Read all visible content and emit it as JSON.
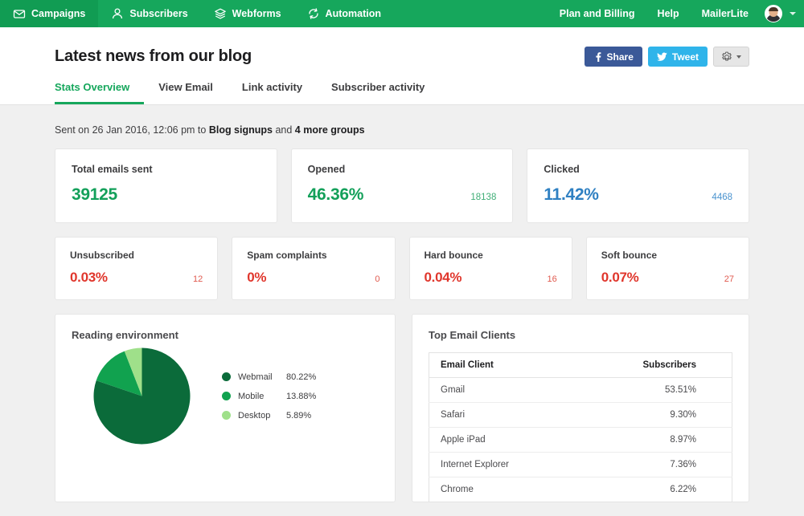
{
  "topnav": {
    "items": [
      {
        "label": "Campaigns",
        "icon": "envelope-icon",
        "active": true
      },
      {
        "label": "Subscribers",
        "icon": "user-icon",
        "active": false
      },
      {
        "label": "Webforms",
        "icon": "layers-icon",
        "active": false
      },
      {
        "label": "Automation",
        "icon": "refresh-icon",
        "active": false
      }
    ],
    "links": [
      {
        "label": "Plan and Billing"
      },
      {
        "label": "Help"
      },
      {
        "label": "MailerLite"
      }
    ],
    "avatar_name": "user-avatar",
    "caret_name": "account-chevron-down-icon",
    "bg_color": "#16a75c",
    "active_bg_color": "#119c53"
  },
  "header": {
    "title": "Latest news from our blog",
    "share_label": "Share",
    "tweet_label": "Tweet",
    "share_color": "#3b5998",
    "tweet_color": "#2fb4ea",
    "settings_icon": "gear-icon"
  },
  "tabs": [
    {
      "label": "Stats Overview",
      "active": true
    },
    {
      "label": "View Email",
      "active": false
    },
    {
      "label": "Link activity",
      "active": false
    },
    {
      "label": "Subscriber activity",
      "active": false
    }
  ],
  "sent_line": {
    "prefix": "Sent on 26 Jan 2016, 12:06 pm to ",
    "group": "Blog signups",
    "middle": " and ",
    "more": "4 more groups"
  },
  "stats_primary": [
    {
      "label": "Total emails sent",
      "value": "39125",
      "count": "",
      "color": "green"
    },
    {
      "label": "Opened",
      "value": "46.36%",
      "count": "18138",
      "color": "green"
    },
    {
      "label": "Clicked",
      "value": "11.42%",
      "count": "4468",
      "color": "blue"
    }
  ],
  "stats_secondary": [
    {
      "label": "Unsubscribed",
      "value": "0.03%",
      "count": "12",
      "color": "red"
    },
    {
      "label": "Spam complaints",
      "value": "0%",
      "count": "0",
      "color": "red"
    },
    {
      "label": "Hard bounce",
      "value": "0.04%",
      "count": "16",
      "color": "red"
    },
    {
      "label": "Soft bounce",
      "value": "0.07%",
      "count": "27",
      "color": "red"
    }
  ],
  "reading_environment": {
    "title": "Reading environment"
  },
  "top_email_clients": {
    "title": "Top Email Clients",
    "columns": [
      "Email Client",
      "Subscribers"
    ],
    "rows": [
      {
        "client": "Gmail",
        "subscribers": "53.51%"
      },
      {
        "client": "Safari",
        "subscribers": "9.30%"
      },
      {
        "client": "Apple iPad",
        "subscribers": "8.97%"
      },
      {
        "client": "Internet Explorer",
        "subscribers": "7.36%"
      },
      {
        "client": "Chrome",
        "subscribers": "6.22%"
      }
    ]
  },
  "chart_data": {
    "type": "pie",
    "title": "Reading environment",
    "categories": [
      "Webmail",
      "Mobile",
      "Desktop"
    ],
    "values": [
      80.22,
      13.88,
      5.89
    ],
    "labels": [
      "80.22%",
      "13.88%",
      "5.89%"
    ],
    "colors": [
      "#0b6b3a",
      "#11a24f",
      "#9fe08a"
    ],
    "legend_position": "right",
    "unit": "%",
    "start_angle_deg": 0,
    "direction": "clockwise"
  }
}
